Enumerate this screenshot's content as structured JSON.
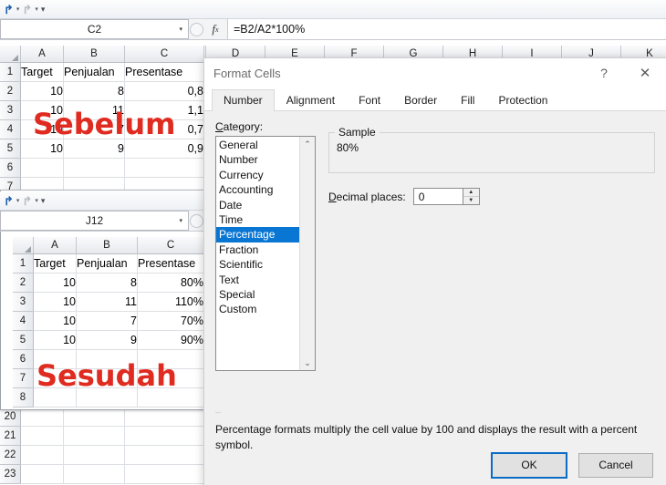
{
  "window_top": {
    "quick_access": {
      "undo": "↰",
      "redo": "↱",
      "customize": "▾"
    },
    "name_box_value": "C2",
    "fx_label": "fx",
    "formula_value": "=B2/A2*100%",
    "grid": {
      "columns": [
        "A",
        "B",
        "C"
      ],
      "rows": [
        {
          "num": "1",
          "cells": [
            "Target",
            "Penjualan",
            "Presentase"
          ],
          "align": "txt"
        },
        {
          "num": "2",
          "cells": [
            "10",
            "8",
            "0,8"
          ],
          "align": "num"
        },
        {
          "num": "3",
          "cells": [
            "10",
            "11",
            "1,1"
          ],
          "align": "num"
        },
        {
          "num": "4",
          "cells": [
            "10",
            "7",
            "0,7"
          ],
          "align": "num"
        },
        {
          "num": "5",
          "cells": [
            "10",
            "9",
            "0,9"
          ],
          "align": "num"
        },
        {
          "num": "6",
          "cells": [
            "",
            "",
            ""
          ],
          "align": "num"
        },
        {
          "num": "7",
          "cells": [
            "",
            "",
            ""
          ],
          "align": "num"
        }
      ]
    },
    "overlay_label": "Sebelum",
    "overlay_color": "#e02b20"
  },
  "window_bottom": {
    "quick_access": {
      "undo": "↰",
      "redo": "↱",
      "customize": "▾"
    },
    "name_box_value": "J12",
    "grid": {
      "columns": [
        "A",
        "B",
        "C"
      ],
      "rows": [
        {
          "num": "1",
          "cells": [
            "Target",
            "Penjualan",
            "Presentase"
          ],
          "align": "txt"
        },
        {
          "num": "2",
          "cells": [
            "10",
            "8",
            "80%"
          ],
          "align": "num"
        },
        {
          "num": "3",
          "cells": [
            "10",
            "11",
            "110%"
          ],
          "align": "num"
        },
        {
          "num": "4",
          "cells": [
            "10",
            "7",
            "70%"
          ],
          "align": "num"
        },
        {
          "num": "5",
          "cells": [
            "10",
            "9",
            "90%"
          ],
          "align": "num"
        },
        {
          "num": "6",
          "cells": [
            "",
            "",
            ""
          ],
          "align": "num"
        },
        {
          "num": "7",
          "cells": [
            "",
            "",
            ""
          ],
          "align": "num"
        },
        {
          "num": "8",
          "cells": [
            "",
            "",
            ""
          ],
          "align": "num"
        }
      ]
    },
    "overlay_label": "Sesudah",
    "overlay_color": "#e02b20"
  },
  "background_sheet": {
    "columns": [
      "D",
      "E",
      "F",
      "G",
      "H",
      "I",
      "J",
      "K"
    ],
    "bottom_rows": [
      "20",
      "21",
      "22",
      "23"
    ]
  },
  "dialog": {
    "title": "Format Cells",
    "help_icon": "?",
    "close_icon": "✕",
    "tabs": [
      {
        "label": "Number",
        "active": true
      },
      {
        "label": "Alignment",
        "active": false
      },
      {
        "label": "Font",
        "active": false
      },
      {
        "label": "Border",
        "active": false
      },
      {
        "label": "Fill",
        "active": false
      },
      {
        "label": "Protection",
        "active": false
      }
    ],
    "category_label": "Category:",
    "categories": [
      {
        "label": "General",
        "selected": false
      },
      {
        "label": "Number",
        "selected": false
      },
      {
        "label": "Currency",
        "selected": false
      },
      {
        "label": "Accounting",
        "selected": false
      },
      {
        "label": "Date",
        "selected": false
      },
      {
        "label": "Time",
        "selected": false
      },
      {
        "label": "Percentage",
        "selected": true
      },
      {
        "label": "Fraction",
        "selected": false
      },
      {
        "label": "Scientific",
        "selected": false
      },
      {
        "label": "Text",
        "selected": false
      },
      {
        "label": "Special",
        "selected": false
      },
      {
        "label": "Custom",
        "selected": false
      }
    ],
    "scroll_up_icon": "⌃",
    "scroll_down_icon": "⌄",
    "sample_legend": "Sample",
    "sample_value": "80%",
    "decimal_label": "Decimal places:",
    "decimal_value": "0",
    "spin_up_icon": "▲",
    "spin_down_icon": "▼",
    "description": "Percentage formats multiply the cell value by 100 and displays the result with a percent symbol.",
    "ok_label": "OK",
    "cancel_label": "Cancel",
    "accent_color": "#0a76d3"
  }
}
